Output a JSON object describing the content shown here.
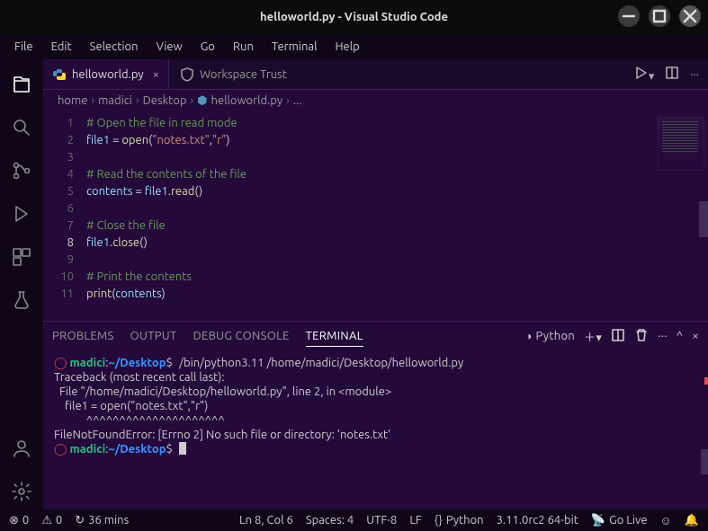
{
  "window": {
    "title": "helloworld.py - Visual Studio Code"
  },
  "menu": [
    "File",
    "Edit",
    "Selection",
    "View",
    "Go",
    "Run",
    "Terminal",
    "Help"
  ],
  "tabs": {
    "file": "helloworld.py",
    "trust": "Workspace Trust"
  },
  "breadcrumbs": [
    "home",
    "madici",
    "Desktop",
    "helloworld.py",
    "..."
  ],
  "code": {
    "lines": [
      {
        "n": 1,
        "t": "comment",
        "text": "# Open the file in read mode"
      },
      {
        "n": 2,
        "t": "assign_open"
      },
      {
        "n": 3,
        "t": "blank"
      },
      {
        "n": 4,
        "t": "comment",
        "text": "# Read the contents of the file"
      },
      {
        "n": 5,
        "t": "assign_read"
      },
      {
        "n": 6,
        "t": "blank"
      },
      {
        "n": 7,
        "t": "comment",
        "text": "# Close the file"
      },
      {
        "n": 8,
        "t": "close"
      },
      {
        "n": 9,
        "t": "blank"
      },
      {
        "n": 10,
        "t": "comment",
        "text": "# Print the contents"
      },
      {
        "n": 11,
        "t": "print"
      }
    ],
    "tokens": {
      "file1": "file1",
      "eq": " = ",
      "open": "open",
      "lp": "(",
      "rp": ")",
      "comma": ",",
      "notes": "\"notes.txt\"",
      "r": "\"r\"",
      "contents": "contents",
      "dot": ".",
      "read": "read",
      "close": "close",
      "print": "print"
    },
    "current_line": 8
  },
  "panel": {
    "tabs": [
      "PROBLEMS",
      "OUTPUT",
      "DEBUG CONSOLE",
      "TERMINAL"
    ],
    "active": "TERMINAL",
    "lang": "Python"
  },
  "terminal": {
    "prompt_user": "madici",
    "prompt_sep": ":",
    "prompt_path": "~/Desktop",
    "prompt_end": "$",
    "cmd": "/bin/python3.11 /home/madici/Desktop/helloworld.py",
    "line1": "Traceback (most recent call last):",
    "line2": "  File \"/home/madici/Desktop/helloworld.py\", line 2, in <module>",
    "line3": "    file1 = open(\"notes.txt\",\"r\")",
    "line4": "            ^^^^^^^^^^^^^^^^^^^^^",
    "line5": "FileNotFoundError: [Errno 2] No such file or directory: 'notes.txt'"
  },
  "status": {
    "errors": "0",
    "warnings": "0",
    "time": "36 mins",
    "pos": "Ln 8, Col 6",
    "spaces": "Spaces: 4",
    "enc": "UTF-8",
    "eol": "LF",
    "lang": "Python",
    "interp": "3.11.0rc2 64-bit",
    "golive": "Go Live"
  }
}
